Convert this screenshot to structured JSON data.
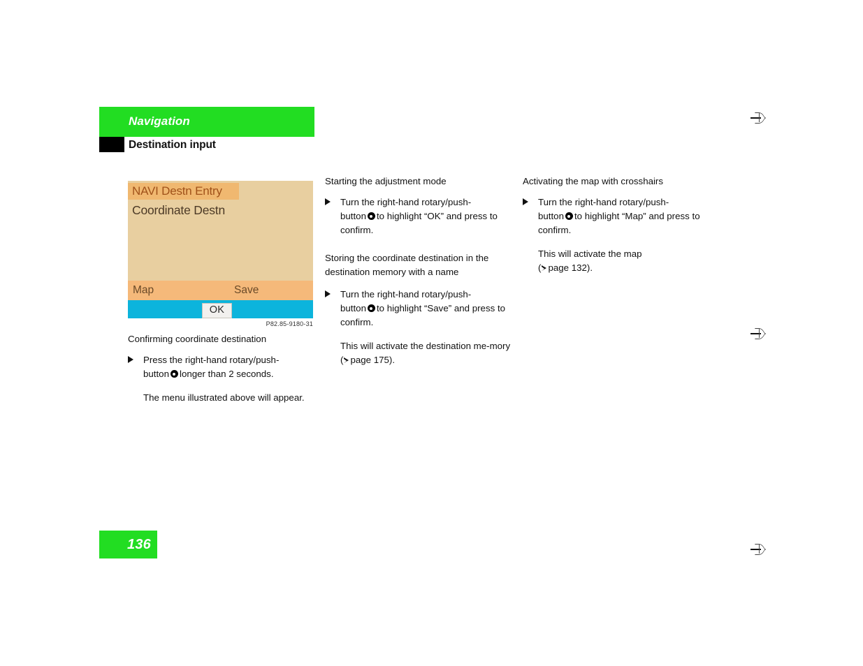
{
  "header": {
    "chapter": "Navigation",
    "section": "Destination input"
  },
  "figure": {
    "code": "P82.85-9180-31",
    "screen": {
      "title": "NAVI Destn Entry",
      "subtitle": "Coordinate Destn",
      "softkey_left": "Map",
      "softkey_right": "Save",
      "ok_button": "OK"
    },
    "colors": {
      "background": "#e8cfa0",
      "title_highlight": "#f0b870",
      "softkey_bar": "#f5b97a",
      "ok_bar": "#0cb4dc",
      "title_text": "#a0521a"
    }
  },
  "columns": {
    "left": {
      "heading": "Confirming coordinate destination",
      "step_part1": "Press the right-hand rotary/push-",
      "step_part2": "button",
      "step_part3": "longer than 2 seconds.",
      "note": "The menu illustrated above will appear."
    },
    "middle": {
      "heading_1": "Starting the adjustment mode",
      "step1_part1": "Turn the right-hand rotary/push-",
      "step1_part2": "button",
      "step1_part3": "to highlight “OK” and press to confirm.",
      "heading_2": "Storing the coordinate destination in the destination memory with a name",
      "step2_part1": "Turn the right-hand rotary/push-",
      "step2_part2": "button",
      "step2_part3": "to highlight “Save” and press to confirm.",
      "note_part1": "This will activate the destination me‑mory (",
      "note_part2": "page 175)."
    },
    "right": {
      "heading": "Activating the map with crosshairs",
      "step_part1": "Turn the right-hand rotary/push-",
      "step_part2": "button",
      "step_part3": "to highlight “Map” and press to confirm.",
      "note_part1": "This will activate the map",
      "note_part2": "(",
      "note_part3": "page 132)."
    }
  },
  "footer": {
    "page_number": "136",
    "accent_color": "#22dd22"
  }
}
